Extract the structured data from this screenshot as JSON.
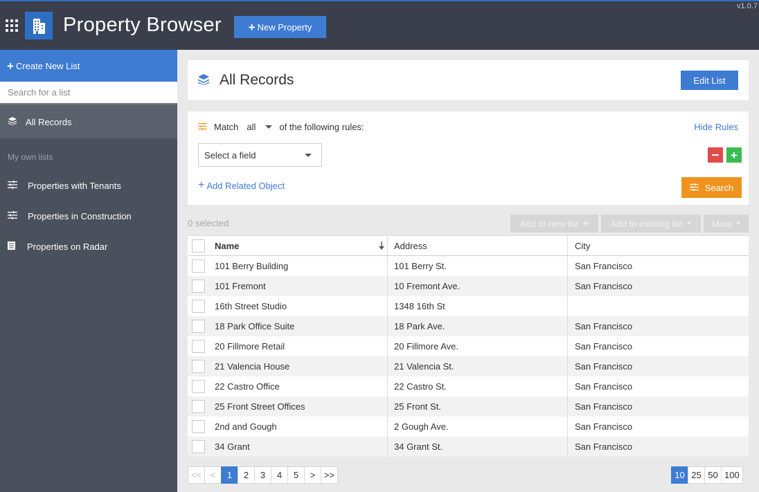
{
  "app": {
    "title": "Property Browser",
    "new_property_label": "New Property",
    "version": "v1.0.7"
  },
  "sidebar": {
    "create_list_label": "Create New List",
    "search_placeholder": "Search for a list",
    "all_records_label": "All Records",
    "section_label": "My own lists",
    "items": [
      {
        "label": "Properties with Tenants",
        "icon": "filter-lines-icon"
      },
      {
        "label": "Properties in Construction",
        "icon": "filter-lines-icon"
      },
      {
        "label": "Properties on Radar",
        "icon": "list-doc-icon"
      }
    ]
  },
  "main": {
    "title": "All Records",
    "edit_list_label": "Edit List"
  },
  "rules": {
    "match_label": "Match",
    "match_value": "all",
    "rules_suffix": "of the following rules:",
    "hide_rules_label": "Hide Rules",
    "field_placeholder": "Select a field",
    "add_related_label": "Add Related Object",
    "search_label": "Search"
  },
  "selection": {
    "count_label": "0 selected",
    "add_new_list_label": "Add to new list",
    "add_existing_list_label": "Add to existing list",
    "more_label": "More"
  },
  "table": {
    "columns": [
      "Name",
      "Address",
      "City"
    ],
    "rows": [
      [
        "101 Berry Building",
        "101 Berry St.",
        "San Francisco"
      ],
      [
        "101 Fremont",
        "10 Fremont Ave.",
        "San Francisco"
      ],
      [
        "16th Street Studio",
        "1348 16th St",
        ""
      ],
      [
        "18 Park Office Suite",
        "18 Park Ave.",
        "San Francisco"
      ],
      [
        "20 Fillmore Retail",
        "20 Fillmore Ave.",
        "San Francisco"
      ],
      [
        "21 Valencia House",
        "21 Valencia St.",
        "San Francisco"
      ],
      [
        "22 Castro Office",
        "22 Castro St.",
        "San Francisco"
      ],
      [
        "25 Front Street Offices",
        "25 Front St.",
        "San Francisco"
      ],
      [
        "2nd and Gough",
        "2 Gough Ave.",
        "San Francisco"
      ],
      [
        "34 Grant",
        "34 Grant St.",
        "San Francisco"
      ]
    ]
  },
  "pagination": {
    "first": "<<",
    "prev": "<",
    "pages": [
      "1",
      "2",
      "3",
      "4",
      "5"
    ],
    "current_page": "1",
    "next": ">",
    "last": ">>",
    "page_sizes": [
      "10",
      "25",
      "50",
      "100"
    ],
    "current_page_size": "10"
  },
  "colors": {
    "accent": "#3e7bd3",
    "sidebar": "#4a505c",
    "topbar": "#3a3f4b",
    "search_button": "#f0931e",
    "remove_rule": "#e04b4b",
    "add_rule": "#3cbb52"
  }
}
